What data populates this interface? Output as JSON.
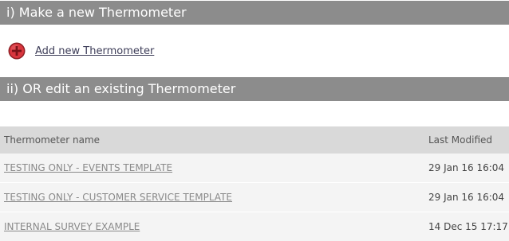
{
  "section1": {
    "title": "i) Make a new Thermometer",
    "add_link": "Add new Thermometer",
    "add_icon": "plus-circle-icon"
  },
  "section2": {
    "title": "ii) OR edit an existing Thermometer"
  },
  "table": {
    "headers": {
      "name": "Thermometer name",
      "modified": "Last Modified"
    },
    "rows": [
      {
        "name": "TESTING ONLY - EVENTS TEMPLATE",
        "modified": "29 Jan 16 16:04"
      },
      {
        "name": "TESTING ONLY - CUSTOMER SERVICE TEMPLATE",
        "modified": "29 Jan 16 16:04"
      },
      {
        "name": "INTERNAL SURVEY EXAMPLE",
        "modified": "14 Dec 15 17:17"
      }
    ]
  },
  "colors": {
    "section_bar": "#8c8c8c",
    "header_row": "#d9d9d9",
    "row_bg": "#f4f4f4",
    "add_icon": "#d9363e"
  }
}
